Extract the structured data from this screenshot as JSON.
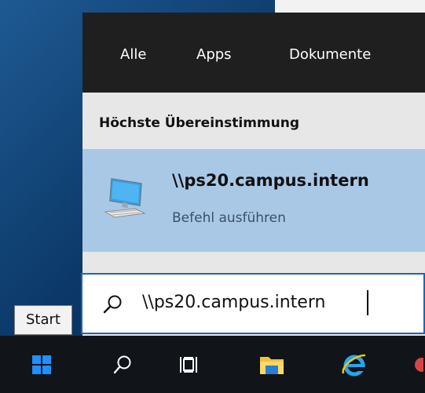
{
  "start_menu": {
    "tabs": [
      {
        "label": "Alle"
      },
      {
        "label": "Apps"
      },
      {
        "label": "Dokumente"
      }
    ],
    "section_title": "Höchste Übereinstimmung",
    "best_match": {
      "title": "\\\\ps20.campus.intern",
      "subtitle": "Befehl ausführen",
      "icon": "computer-icon"
    }
  },
  "search": {
    "value": "\\\\ps20.campus.intern",
    "icon": "search-icon"
  },
  "tooltip": {
    "text": "Start"
  },
  "taskbar": {
    "items": [
      {
        "name": "start",
        "icon": "windows-logo-icon"
      },
      {
        "name": "search",
        "icon": "search-icon"
      },
      {
        "name": "task-view",
        "icon": "task-view-icon"
      },
      {
        "name": "file-explorer",
        "icon": "folder-icon"
      },
      {
        "name": "internet-explorer",
        "icon": "internet-explorer-icon"
      }
    ]
  },
  "colors": {
    "taskbar": "#111418",
    "panel_header": "#1f1f1f",
    "highlight": "#a8c8e6",
    "search_border": "#1b66b3",
    "windows_blue": "#1e90ff"
  }
}
